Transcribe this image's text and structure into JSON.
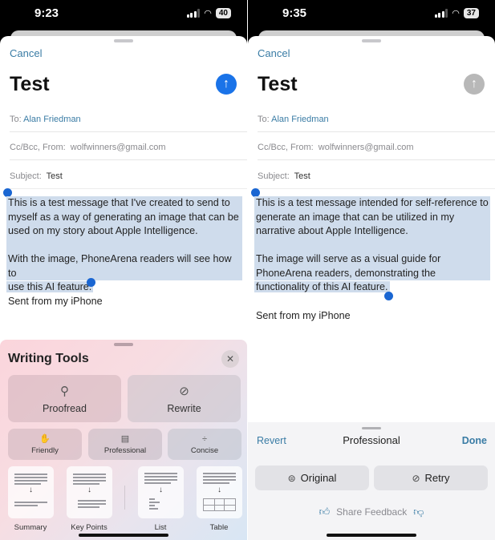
{
  "left": {
    "status": {
      "time": "9:23",
      "battery": "40"
    },
    "cancel": "Cancel",
    "title": "Test",
    "to_label": "To:",
    "to_value": "Alan Friedman",
    "cc_label": "Cc/Bcc, From:",
    "cc_value": "wolfwinners@gmail.com",
    "subject_label": "Subject:",
    "subject_value": "Test",
    "body_lines_p1": [
      "This is a test message that I've created to send to",
      "myself as a way of generating an image that can be",
      "used on my story about Apple Intelligence."
    ],
    "body_lines_p2": [
      "With the image, PhoneArena readers will see how to",
      "use this AI feature."
    ],
    "signature": "Sent from my iPhone",
    "writing_tools": {
      "title": "Writing Tools",
      "proofread": "Proofread",
      "rewrite": "Rewrite",
      "friendly": "Friendly",
      "professional": "Professional",
      "concise": "Concise",
      "summary": "Summary",
      "key_points": "Key Points",
      "list": "List",
      "table": "Table"
    }
  },
  "right": {
    "status": {
      "time": "9:35",
      "battery": "37"
    },
    "cancel": "Cancel",
    "title": "Test",
    "to_label": "To:",
    "to_value": "Alan Friedman",
    "cc_label": "Cc/Bcc, From:",
    "cc_value": "wolfwinners@gmail.com",
    "subject_label": "Subject:",
    "subject_value": "Test",
    "body_lines_p1": [
      "This is a test message intended for self-reference to",
      "generate an image that can be utilized in my",
      "narrative about Apple Intelligence."
    ],
    "body_lines_p2": [
      "The image will serve as a visual guide for",
      "PhoneArena readers, demonstrating the",
      "functionality of this AI feature."
    ],
    "signature": "Sent from my iPhone",
    "panel": {
      "revert": "Revert",
      "title": "Professional",
      "done": "Done",
      "original": "Original",
      "retry": "Retry",
      "feedback": "Share Feedback"
    }
  }
}
